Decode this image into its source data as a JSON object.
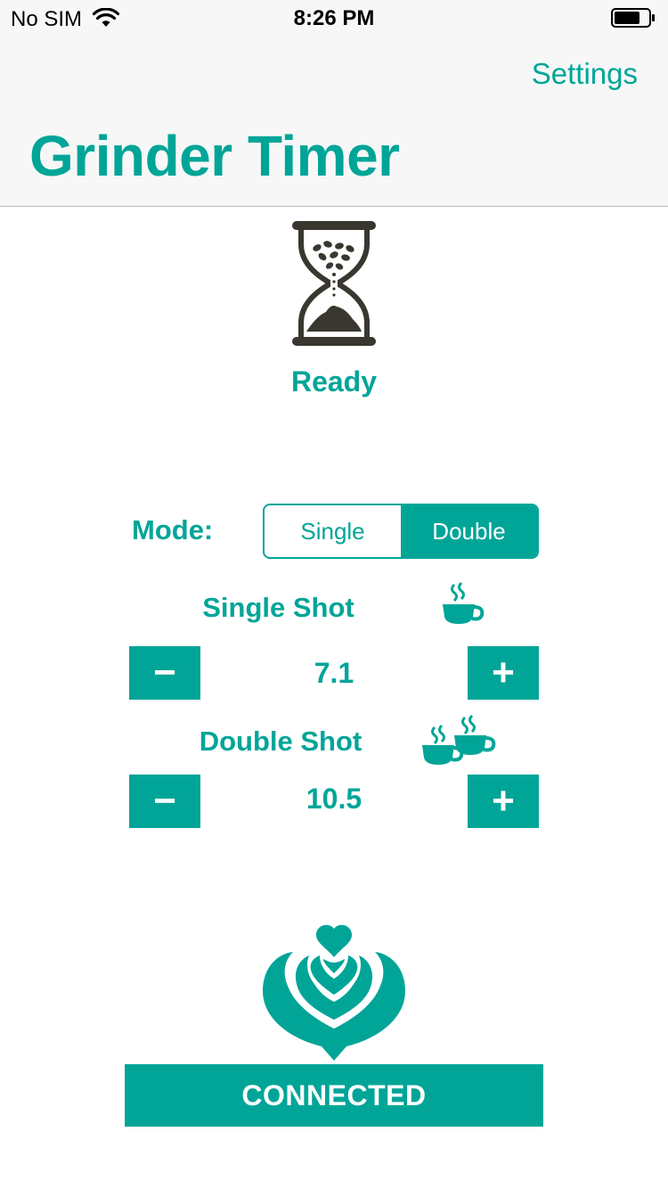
{
  "status_bar": {
    "carrier": "No SIM",
    "time": "8:26 PM",
    "wifi_icon": "wifi-icon",
    "battery_icon": "battery-icon"
  },
  "navbar": {
    "settings_label": "Settings",
    "title": "Grinder Timer"
  },
  "timer": {
    "icon": "hourglass-coffee-icon",
    "status": "Ready"
  },
  "mode": {
    "label": "Mode:",
    "options": [
      "Single",
      "Double"
    ],
    "selected": "Double"
  },
  "single_shot": {
    "label": "Single Shot",
    "icon": "coffee-cup-icon",
    "value": "7.1",
    "minus_label": "−",
    "plus_label": "+"
  },
  "double_shot": {
    "label": "Double Shot",
    "icon": "double-coffee-cup-icon",
    "value": "10.5",
    "minus_label": "−",
    "plus_label": "+"
  },
  "logo": {
    "icon": "latte-art-icon"
  },
  "connection": {
    "button_label": "CONNECTED"
  },
  "colors": {
    "accent": "#00A598",
    "hourglass": "#3A3730",
    "navbar_bg": "#F7F7F7"
  }
}
